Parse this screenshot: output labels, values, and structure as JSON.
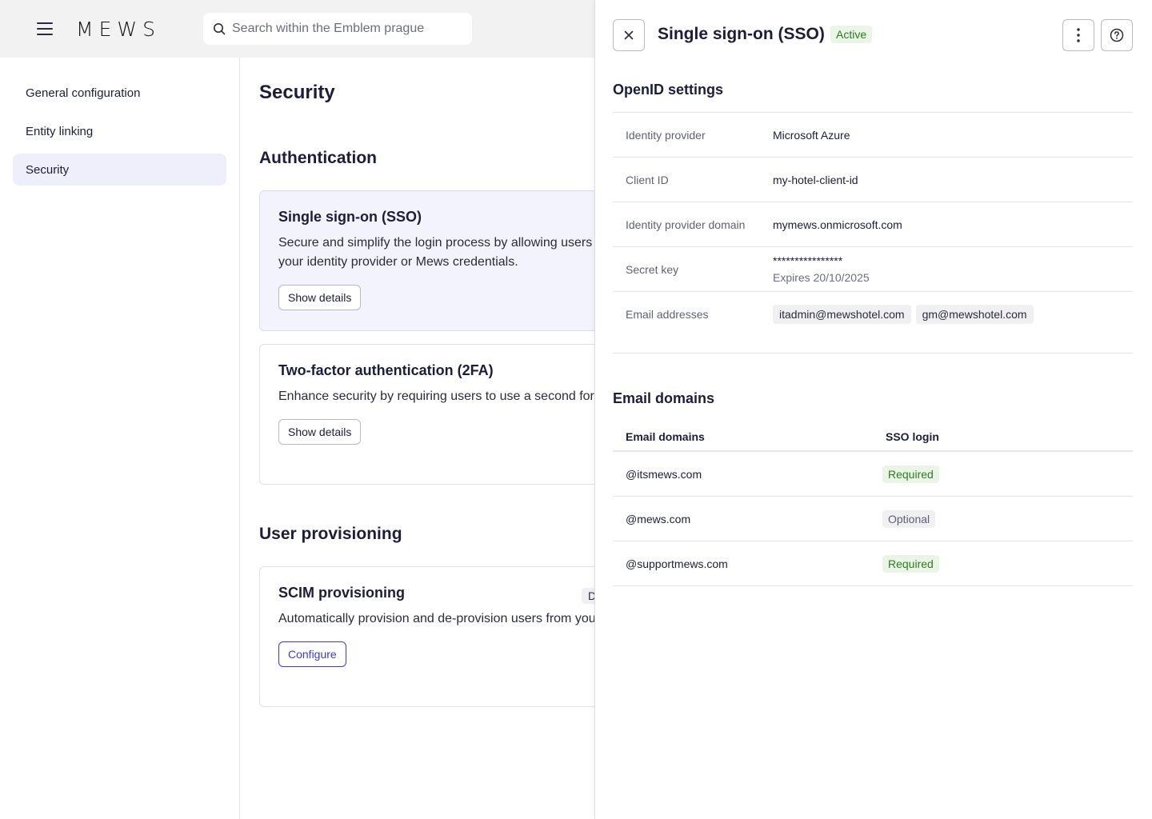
{
  "app": {
    "logo": "MEWS"
  },
  "search": {
    "placeholder": "Search within the Emblem prague"
  },
  "sidebar": {
    "items": [
      {
        "label": "General configuration"
      },
      {
        "label": "Entity linking"
      },
      {
        "label": "Security",
        "active": true
      }
    ]
  },
  "main": {
    "title": "Security",
    "authentication": {
      "title": "Authentication",
      "sso": {
        "title": "Single sign-on (SSO)",
        "description": "Secure and simplify the login process by allowing users to sign in through your identity provider or Mews credentials.",
        "button": "Show details"
      },
      "twofa": {
        "title": "Two-factor authentication (2FA)",
        "description": "Enhance security by requiring users to use a second form of identification.",
        "button": "Show details"
      }
    },
    "provisioning": {
      "title": "User provisioning",
      "scim": {
        "title": "SCIM provisioning",
        "badge": "D",
        "description": "Automatically provision and de-provision users from your identity provider.",
        "button": "Configure"
      }
    }
  },
  "drawer": {
    "title": "Single sign-on (SSO)",
    "status": "Active",
    "openid": {
      "title": "OpenID settings",
      "identity_provider_label": "Identity provider",
      "identity_provider": "Microsoft Azure",
      "client_id_label": "Client ID",
      "client_id": "my-hotel-client-id",
      "domain_label": "Identity provider domain",
      "domain": "mymews.onmicrosoft.com",
      "secret_label": "Secret key",
      "secret": "****************",
      "secret_expiry": "Expires 20/10/2025",
      "emails_label": "Email addresses",
      "emails": [
        "itadmin@mewshotel.com",
        "gm@mewshotel.com"
      ]
    },
    "email_domains": {
      "title": "Email domains",
      "col_domain": "Email domains",
      "col_login": "SSO login",
      "rows": [
        {
          "domain": "@itsmews.com",
          "login": "Required"
        },
        {
          "domain": "@mews.com",
          "login": "Optional"
        },
        {
          "domain": "@supportmews.com",
          "login": "Required"
        }
      ]
    }
  },
  "colors": {
    "accent": "#3b3ad6",
    "required": "#2d7a1f",
    "active_nav": "#eeeffb"
  }
}
